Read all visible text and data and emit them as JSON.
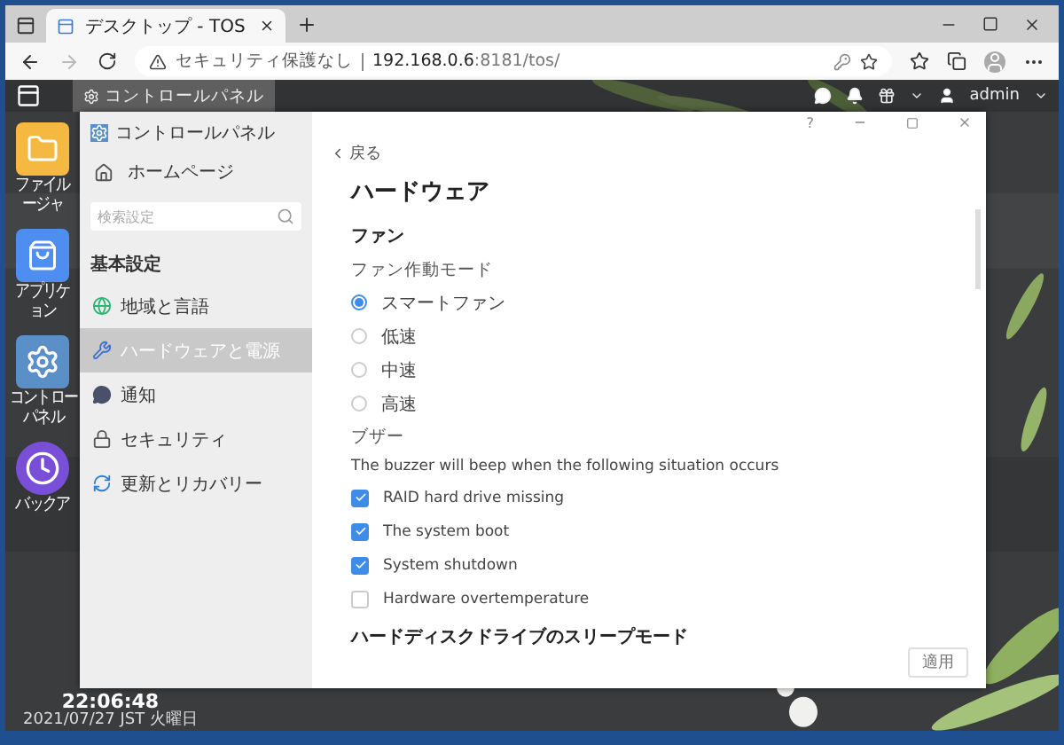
{
  "browser": {
    "tab": {
      "title": "デスクトップ - TOS"
    },
    "address": {
      "security": "セキュリティ保護なし",
      "host": "192.168.0.6",
      "rest": ":8181/tos/"
    }
  },
  "taskbar": {
    "app": "コントロールパネル",
    "user": "admin"
  },
  "desktop_icons": [
    {
      "kind": "folder",
      "lines": [
        "ファイル",
        "ージャ"
      ]
    },
    {
      "kind": "bag",
      "lines": [
        "アプリケ",
        "ョン"
      ]
    },
    {
      "kind": "gear",
      "lines": [
        "コントロー",
        "パネル"
      ]
    },
    {
      "kind": "clock",
      "lines": [
        "バックア"
      ]
    }
  ],
  "clock": {
    "time": "22:06:48",
    "date": "2021/07/27 JST 火曜日"
  },
  "window": {
    "title": "コントロールパネル",
    "home": "ホームページ",
    "search": {
      "placeholder": "検索設定"
    },
    "section": "基本設定",
    "nav": [
      {
        "kind": "globe",
        "label": "地域と言語",
        "selected": false
      },
      {
        "kind": "tools",
        "label": "ハードウェアと電源",
        "selected": true
      },
      {
        "kind": "chat",
        "label": "通知",
        "selected": false
      },
      {
        "kind": "lock",
        "label": "セキュリティ",
        "selected": false
      },
      {
        "kind": "update",
        "label": "更新とリカバリー",
        "selected": false
      }
    ],
    "help": "?",
    "back": "戻る",
    "heading": "ハードウェア",
    "fan_title": "ファン",
    "fan_mode_label": "ファン作動モード",
    "fan_modes": [
      {
        "label": "スマートファン",
        "selected": true
      },
      {
        "label": "低速",
        "selected": false
      },
      {
        "label": "中速",
        "selected": false
      },
      {
        "label": "高速",
        "selected": false
      }
    ],
    "buzzer_title": "ブザー",
    "buzzer_desc": "The buzzer will beep when the following situation occurs",
    "buzzer_events": [
      {
        "label": "RAID hard drive missing",
        "checked": true
      },
      {
        "label": "The system boot",
        "checked": true
      },
      {
        "label": "System shutdown",
        "checked": true
      },
      {
        "label": "Hardware overtemperature",
        "checked": false
      }
    ],
    "sleep_title": "ハードディスクドライブのスリープモード",
    "apply": "適用"
  }
}
